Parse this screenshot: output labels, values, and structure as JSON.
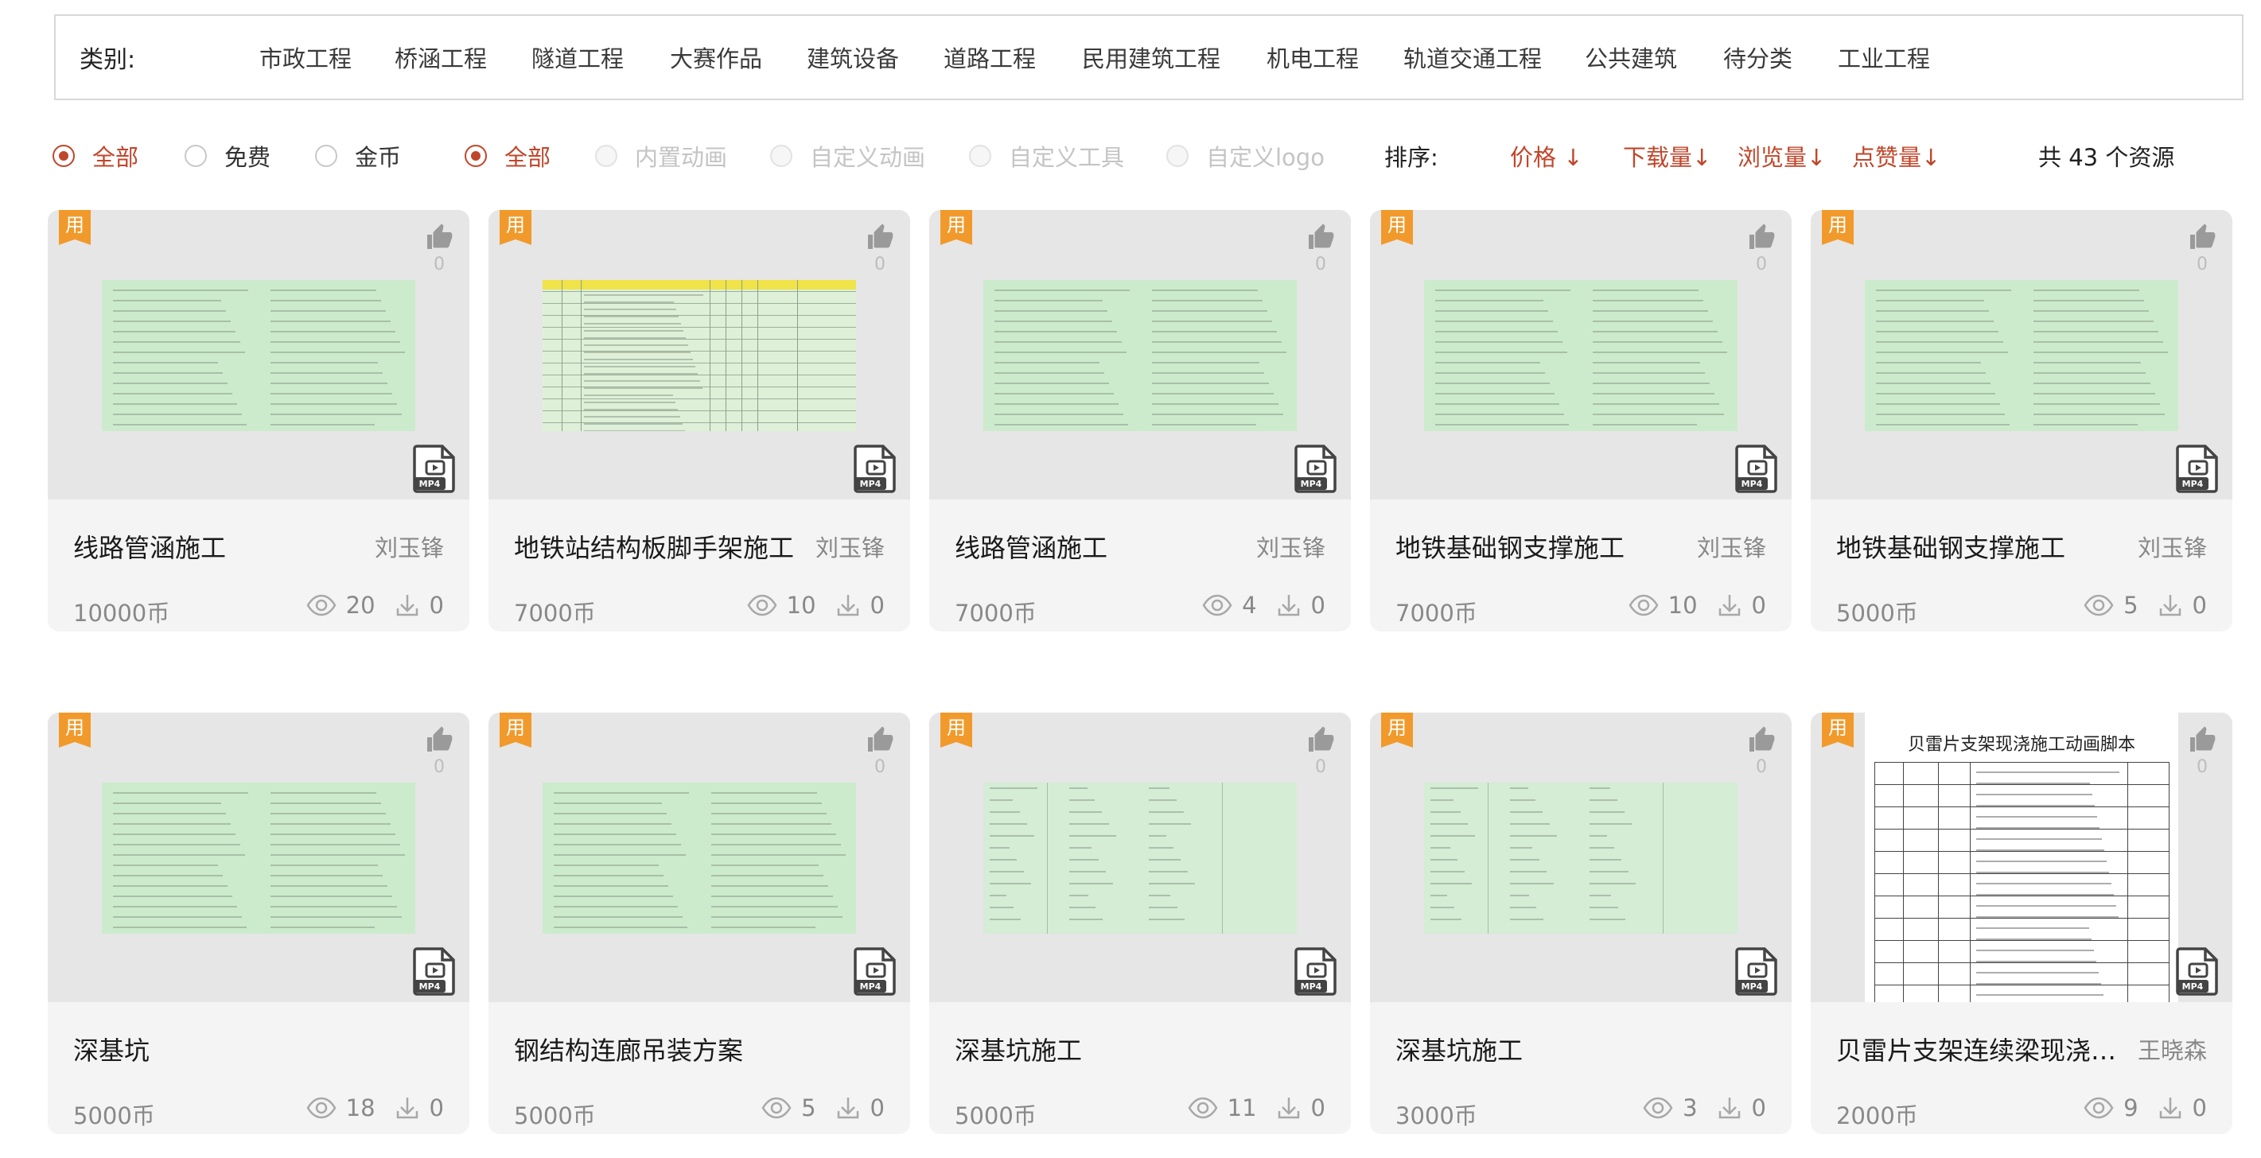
{
  "categories": {
    "label": "类别:",
    "items": [
      "市政工程",
      "桥涵工程",
      "隧道工程",
      "大赛作品",
      "建筑设备",
      "道路工程",
      "民用建筑工程",
      "机电工程",
      "轨道交通工程",
      "公共建筑",
      "待分类",
      "工业工程"
    ]
  },
  "filters": {
    "price_group": [
      {
        "label": "全部",
        "state": "selected"
      },
      {
        "label": "免费",
        "state": "unselected"
      },
      {
        "label": "金币",
        "state": "unselected"
      }
    ],
    "feature_group": [
      {
        "label": "全部",
        "state": "selected"
      },
      {
        "label": "内置动画",
        "state": "disabled"
      },
      {
        "label": "自定义动画",
        "state": "disabled"
      },
      {
        "label": "自定义工具",
        "state": "disabled"
      },
      {
        "label": "自定义logo",
        "state": "disabled"
      }
    ]
  },
  "sort": {
    "label": "排序:",
    "items": [
      "价格 ↓",
      "下载量↓",
      "浏览量↓",
      "点赞量↓"
    ]
  },
  "total": "共 43 个资源",
  "badge_text": "用",
  "file_type_text": "MP4",
  "colors": {
    "accent": "#c0462b",
    "badge": "#f19a2b",
    "doc_green": "#ccebcc"
  },
  "cards": [
    {
      "title": "线路管涵施工",
      "author": "刘玉锋",
      "price": "10000币",
      "views": "20",
      "downloads": "0",
      "likes": "0"
    },
    {
      "title": "地铁站结构板脚手架施工",
      "author": "刘玉锋",
      "price": "7000币",
      "views": "10",
      "downloads": "0",
      "likes": "0"
    },
    {
      "title": "线路管涵施工",
      "author": "刘玉锋",
      "price": "7000币",
      "views": "4",
      "downloads": "0",
      "likes": "0"
    },
    {
      "title": "地铁基础钢支撑施工",
      "author": "刘玉锋",
      "price": "7000币",
      "views": "10",
      "downloads": "0",
      "likes": "0"
    },
    {
      "title": "地铁基础钢支撑施工",
      "author": "刘玉锋",
      "price": "5000币",
      "views": "5",
      "downloads": "0",
      "likes": "0"
    },
    {
      "title": "深基坑",
      "author": "",
      "price": "5000币",
      "views": "18",
      "downloads": "0",
      "likes": "0"
    },
    {
      "title": "钢结构连廊吊装方案",
      "author": "",
      "price": "5000币",
      "views": "5",
      "downloads": "0",
      "likes": "0"
    },
    {
      "title": "深基坑施工",
      "author": "",
      "price": "5000币",
      "views": "11",
      "downloads": "0",
      "likes": "0"
    },
    {
      "title": "深基坑施工",
      "author": "",
      "price": "3000币",
      "views": "3",
      "downloads": "0",
      "likes": "0"
    },
    {
      "title": "贝雷片支架连续梁现浇…",
      "author": "王晓森",
      "price": "2000币",
      "views": "9",
      "downloads": "0",
      "likes": "0",
      "thumb_title": "贝雷片支架现浇施工动画脚本"
    }
  ]
}
